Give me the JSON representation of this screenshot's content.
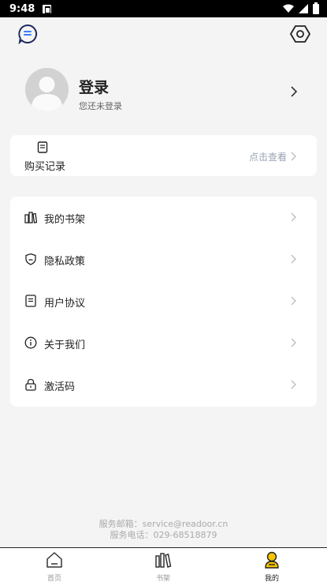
{
  "status_bar": {
    "time": "9:48"
  },
  "header": {
    "message_icon": "message-icon",
    "settings_icon": "settings-icon"
  },
  "profile": {
    "title": "登录",
    "subtitle": "您还未登录"
  },
  "purchase": {
    "label": "购买记录",
    "link": "点击查看"
  },
  "menu": [
    {
      "label": "我的书架",
      "icon": "bookshelf-icon"
    },
    {
      "label": "隐私政策",
      "icon": "shield-icon"
    },
    {
      "label": "用户协议",
      "icon": "document-icon"
    },
    {
      "label": "关于我们",
      "icon": "info-icon"
    },
    {
      "label": "激活码",
      "icon": "lock-icon"
    }
  ],
  "footer": {
    "email_line": "服务邮箱：service@readoor.cn",
    "phone_line": "服务电话：029-68518879"
  },
  "bottom_nav": [
    {
      "label": "首页",
      "icon": "home-icon",
      "active": false
    },
    {
      "label": "书架",
      "icon": "books-icon",
      "active": false
    },
    {
      "label": "我的",
      "icon": "user-icon",
      "active": true
    }
  ],
  "colors": {
    "background": "#f4f4f4",
    "card": "#ffffff",
    "accent": "#f5c400",
    "link": "#9aa4b4"
  }
}
